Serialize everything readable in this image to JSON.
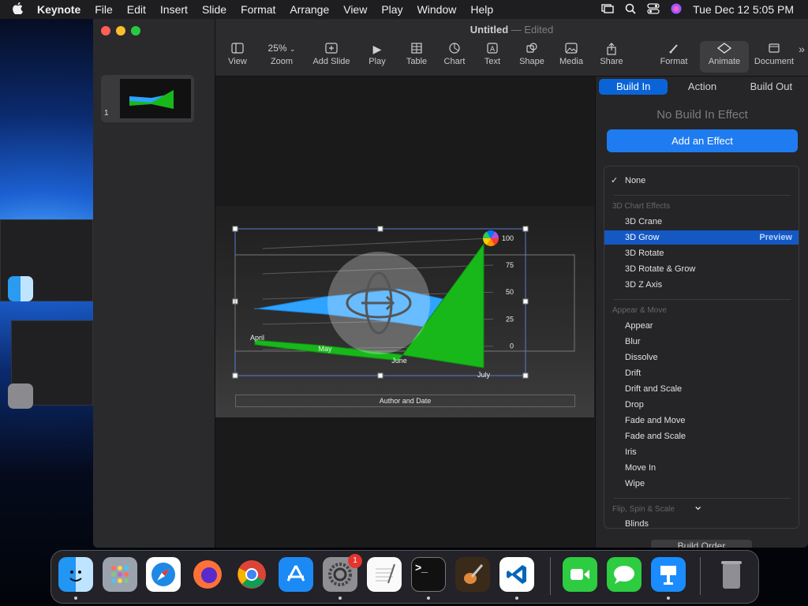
{
  "menubar": {
    "apple": "",
    "app_name": "Keynote",
    "items": [
      "File",
      "Edit",
      "Insert",
      "Slide",
      "Format",
      "Arrange",
      "View",
      "Play",
      "Window",
      "Help"
    ],
    "clock": "Tue Dec 12  5:05 PM"
  },
  "window": {
    "title": "Untitled",
    "title_sep": " — ",
    "status": "Edited"
  },
  "toolbar": {
    "view": "View",
    "zoom_value": "25%",
    "zoom": "Zoom",
    "add_slide": "Add Slide",
    "play": "Play",
    "table": "Table",
    "chart": "Chart",
    "text": "Text",
    "shape": "Shape",
    "media": "Media",
    "share": "Share",
    "format": "Format",
    "animate": "Animate",
    "document": "Document",
    "more": "»"
  },
  "navigator": {
    "slide_number": "1"
  },
  "chart_data": {
    "type": "area",
    "categories": [
      "April",
      "May",
      "June",
      "July"
    ],
    "y_ticks": [
      "0",
      "25",
      "50",
      "75",
      "100"
    ],
    "ylim": [
      0,
      100
    ],
    "series": [
      {
        "color": "#2ea3ff",
        "values": [
          45,
          55,
          60,
          40
        ]
      },
      {
        "color": "#18b81b",
        "values": [
          5,
          -5,
          -15,
          95
        ]
      }
    ]
  },
  "slide": {
    "footer": "Author and Date"
  },
  "inspector": {
    "tabs": [
      "Build In",
      "Action",
      "Build Out"
    ],
    "selected_tab": "Build In",
    "no_build": "No Build In Effect",
    "add_effect": "Add an Effect",
    "build_order": "Build Order"
  },
  "effects": {
    "none": "None",
    "check": "✓",
    "header_3d": "3D Chart Effects",
    "items_3d": [
      "3D Crane",
      "3D Grow",
      "3D Rotate",
      "3D Rotate & Grow",
      "3D Z Axis"
    ],
    "highlighted": "3D Grow",
    "preview": "Preview",
    "header_appear": "Appear & Move",
    "items_appear": [
      "Appear",
      "Blur",
      "Dissolve",
      "Drift",
      "Drift and Scale",
      "Drop",
      "Fade and Move",
      "Fade and Scale",
      "Iris",
      "Move In",
      "Wipe"
    ],
    "header_flip": "Flip, Spin & Scale",
    "cut_item": "Blinds",
    "scroll_indicator": "⌄"
  },
  "dock": {
    "apps": [
      "Finder",
      "Launchpad",
      "Safari",
      "Firefox",
      "Chrome",
      "App Store",
      "System Settings",
      "TextEdit",
      "Terminal",
      "GarageBand",
      "Visual Studio Code",
      "FaceTime",
      "Messages",
      "Keynote",
      "Trash"
    ],
    "settings_badge": "1",
    "terminal_text": ">_"
  },
  "colors": {
    "accent": "#0a64d8",
    "highlight": "#1458c4",
    "button": "#1f7cf0"
  }
}
